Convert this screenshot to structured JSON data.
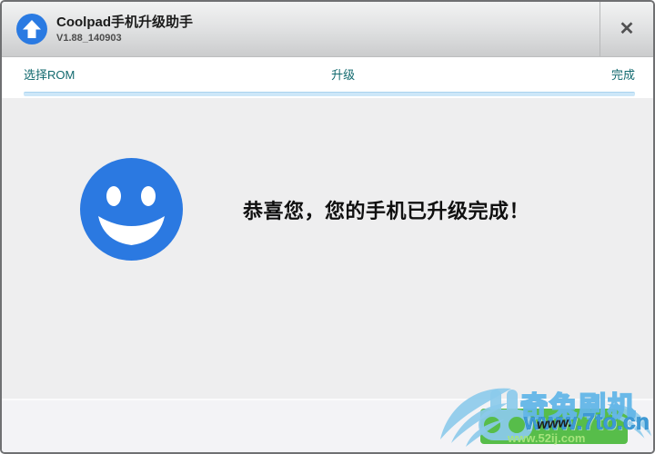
{
  "titlebar": {
    "title": "Coolpad手机升级助手",
    "version": "V1.88_140903",
    "close": "✕"
  },
  "nav": {
    "steps": [
      {
        "label": "选择ROM"
      },
      {
        "label": "升级"
      },
      {
        "label": "完成"
      }
    ]
  },
  "content": {
    "message": "恭喜您，您的手机已升级完成！"
  },
  "watermark": {
    "brand": "奇兔刷机",
    "site": "www.7to.cn",
    "overlay": "www.",
    "site_alt": "www.52ij.com"
  },
  "colors": {
    "accent_blue": "#2b79e1",
    "step_text": "#11696e",
    "progress_bar": "#cde7f8",
    "watermark_blue": "#62b5e7",
    "watermark_green": "#57bd4a"
  }
}
